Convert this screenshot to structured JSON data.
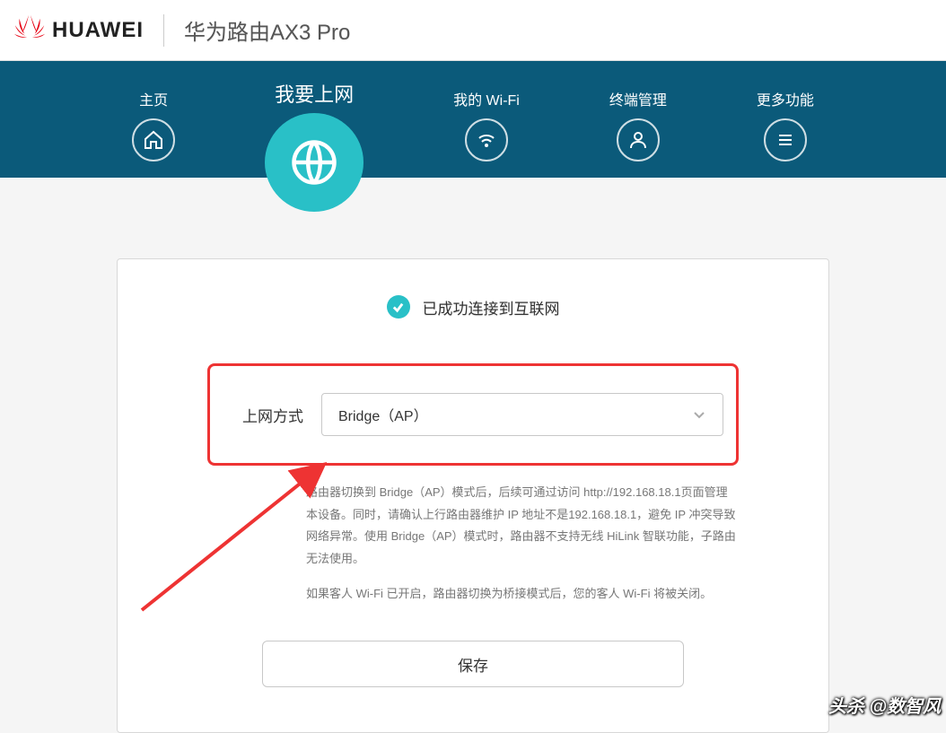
{
  "header": {
    "brand": "HUAWEI",
    "product": "华为路由AX3 Pro"
  },
  "nav": {
    "home": "主页",
    "internet": "我要上网",
    "wifi": "我的 Wi-Fi",
    "devices": "终端管理",
    "more": "更多功能"
  },
  "status": {
    "connected": "已成功连接到互联网"
  },
  "form": {
    "connection_label": "上网方式",
    "connection_value": "Bridge（AP）",
    "help1": "路由器切换到 Bridge（AP）模式后，后续可通过访问 http://192.168.18.1页面管理本设备。同时，请确认上行路由器维护 IP 地址不是192.168.18.1，避免 IP 冲突导致网络异常。使用 Bridge（AP）模式时，路由器不支持无线 HiLink 智联功能，子路由无法使用。",
    "help2": "如果客人 Wi-Fi 已开启，路由器切换为桥接模式后，您的客人 Wi-Fi 将被关闭。",
    "save": "保存"
  },
  "watermark": "头杀 @数智风"
}
